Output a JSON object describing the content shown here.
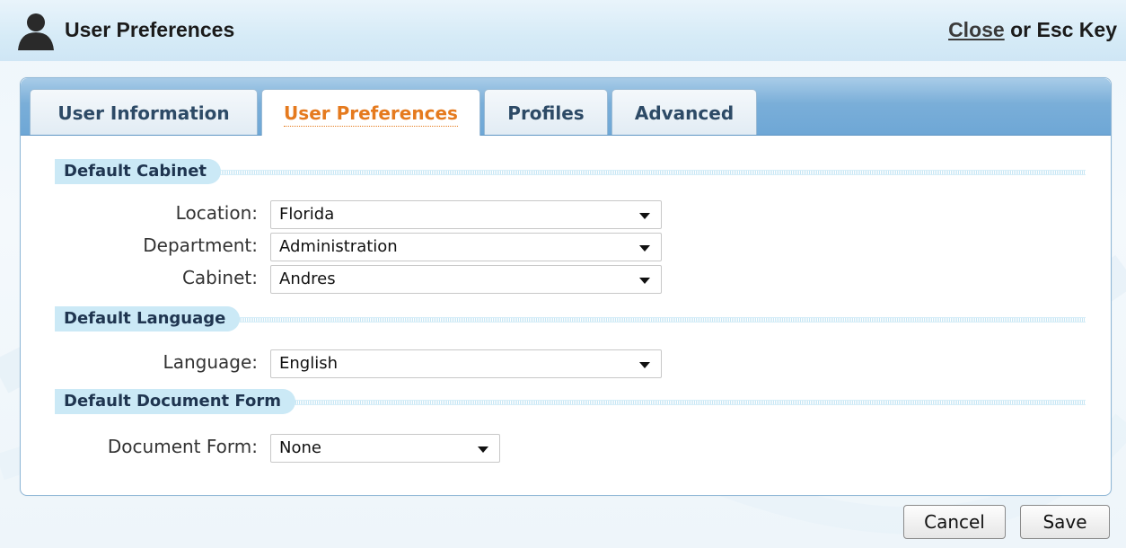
{
  "header": {
    "title": "User Preferences",
    "close_label": "Close",
    "close_suffix": "or Esc Key",
    "icon": "user-icon"
  },
  "tabs": [
    {
      "label": "User Information",
      "active": false
    },
    {
      "label": "User Preferences",
      "active": true
    },
    {
      "label": "Profiles",
      "active": false
    },
    {
      "label": "Advanced",
      "active": false
    }
  ],
  "sections": {
    "cabinet": {
      "title": "Default Cabinet",
      "fields": [
        {
          "label": "Location:",
          "value": "Florida"
        },
        {
          "label": "Department:",
          "value": "Administration"
        },
        {
          "label": "Cabinet:",
          "value": "Andres"
        }
      ]
    },
    "language": {
      "title": "Default Language",
      "fields": [
        {
          "label": "Language:",
          "value": "English"
        }
      ]
    },
    "document_form": {
      "title": "Default Document Form",
      "fields": [
        {
          "label": "Document Form:",
          "value": "None"
        }
      ]
    }
  },
  "buttons": {
    "cancel": "Cancel",
    "save": "Save"
  },
  "colors": {
    "active_tab_text": "#e57a1e",
    "tab_bar": "#7aaed8",
    "section_tag": "#cbe9f6"
  }
}
